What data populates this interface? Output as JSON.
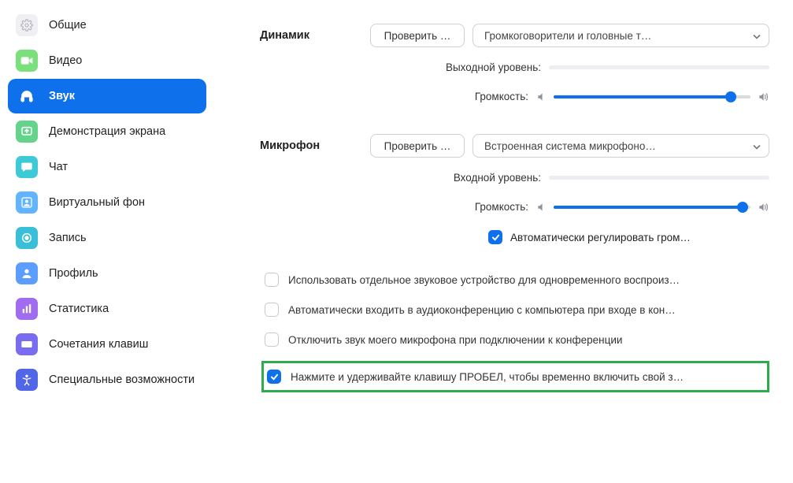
{
  "sidebar": {
    "items": [
      {
        "label": "Общие"
      },
      {
        "label": "Видео"
      },
      {
        "label": "Звук"
      },
      {
        "label": "Демонстрация экрана"
      },
      {
        "label": "Чат"
      },
      {
        "label": "Виртуальный фон"
      },
      {
        "label": "Запись"
      },
      {
        "label": "Профиль"
      },
      {
        "label": "Статистика"
      },
      {
        "label": "Сочетания клавиш"
      },
      {
        "label": "Специальные возможности"
      }
    ]
  },
  "speaker": {
    "title": "Динамик",
    "test_button": "Проверить …",
    "device": "Громкоговорители и головные т…",
    "output_level_label": "Выходной уровень:",
    "volume_label": "Громкость:",
    "volume_percent": 90
  },
  "mic": {
    "title": "Микрофон",
    "test_button": "Проверить …",
    "device": "Встроенная система микрофоно…",
    "input_level_label": "Входной уровень:",
    "volume_label": "Громкость:",
    "volume_percent": 96,
    "auto_adjust_label": "Автоматически регулировать гром…"
  },
  "options": {
    "separate_device": "Использовать отдельное звуковое устройство для одновременного воспроиз…",
    "auto_join_audio": "Автоматически входить в аудиоконференцию с компьютера при входе в кон…",
    "mute_on_join": "Отключить звук моего микрофона при подключении к конференции",
    "push_to_talk": "Нажмите и удерживайте клавишу ПРОБЕЛ, чтобы временно включить свой з…"
  }
}
